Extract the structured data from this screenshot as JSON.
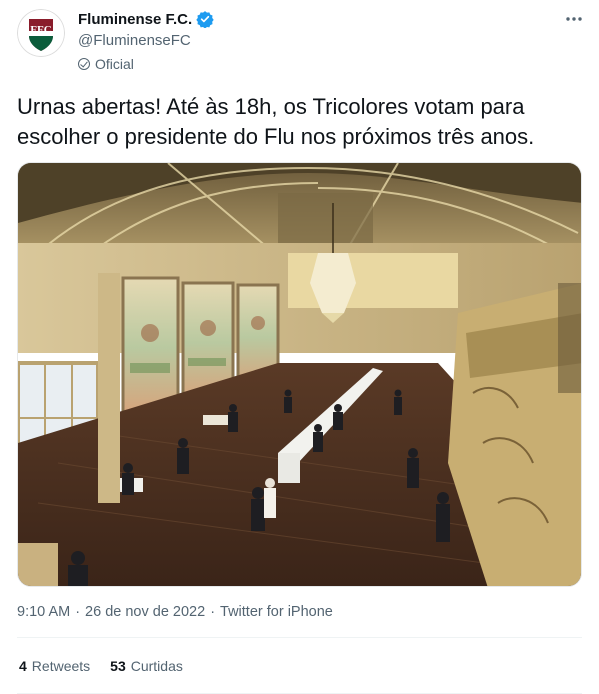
{
  "author": {
    "display_name": "Fluminense F.C.",
    "handle": "@FluminenseFC",
    "label": "Oficial",
    "avatar_icon": "fluminense-crest-icon",
    "verified_icon": "verified-badge-icon",
    "verified_color": "#1d9bf0"
  },
  "tweet": {
    "text": "Urnas abertas! Até às 18h, os Tricolores votam para escolher o presidente do Flu nos próximos três anos.",
    "image_icon": "photo-voting-hall"
  },
  "meta": {
    "time": "9:10 AM",
    "separator1": "·",
    "date": "26 de nov de 2022",
    "separator2": "·",
    "source": "Twitter for iPhone"
  },
  "stats": {
    "retweets_count": "4",
    "retweets_label": "Retweets",
    "likes_count": "53",
    "likes_label": "Curtidas"
  },
  "colors": {
    "text": "#0f1419",
    "secondary": "#536471",
    "club_green": "#0b5c3b",
    "club_maroon": "#8a1c2b"
  }
}
